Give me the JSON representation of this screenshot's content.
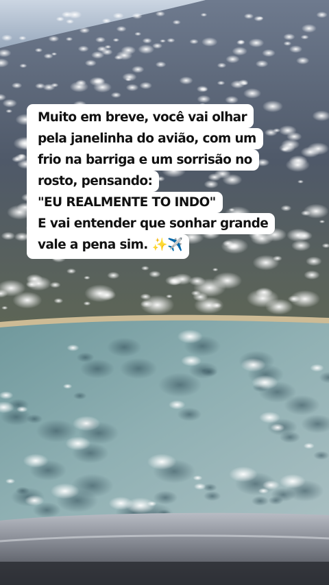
{
  "story": {
    "caption_lines": [
      "Muito em breve, você vai olhar",
      "pela janelinha do avião, com um",
      "frio na barriga e um sorrisão no",
      "rosto, pensando:",
      "\"EU REALMENTE TO INDO\"",
      "E vai entender que sonhar grande",
      "vale a pena sim. ✨✈️"
    ]
  },
  "colors": {
    "sky_haze": "#c9d6e4",
    "land": "#5a6473",
    "sea": "#7fa3a8",
    "beach": "#c7b48f",
    "window_frame": "#9a9ea6",
    "caption_bg": "#ffffff",
    "caption_text": "#111111"
  }
}
